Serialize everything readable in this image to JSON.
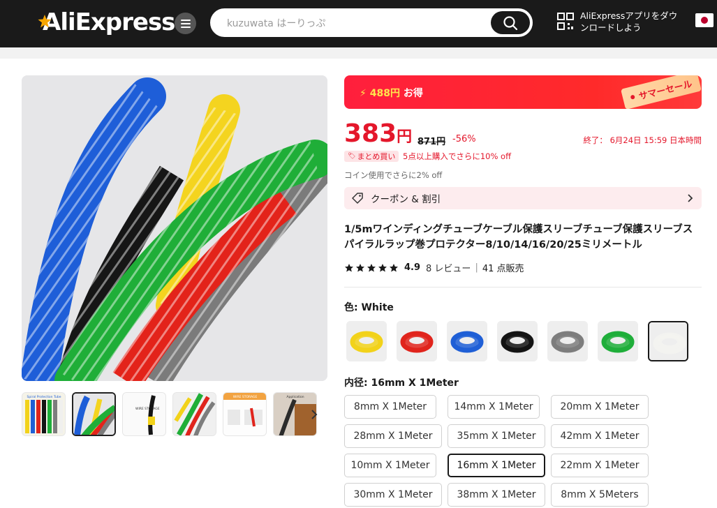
{
  "header": {
    "logo": "AliExpress",
    "search_value": "kuzuwata はーりっぷ",
    "app_promo": "AliExpressアプリをダウンロードしよう"
  },
  "gallery": {
    "thumb_count": 7,
    "thumb_labels": [
      "Spiral Protection Tube",
      "WIRE STORAGE",
      "WIRE STORAGE",
      "Application"
    ]
  },
  "sale": {
    "amount": "488円",
    "suffix": "お得",
    "tag": "サマーセール"
  },
  "price": {
    "current": "383",
    "unit": "円",
    "original": "871円",
    "discount": "-56%",
    "ends": "終了： 6月24日 15:59 日本時間",
    "bulk_badge": "まとめ買い",
    "bulk_text": "5点以上購入でさらに10% off",
    "coin_text": "コイン使用でさらに2% off"
  },
  "coupon": {
    "label": "クーポン & 割引"
  },
  "product": {
    "title": "1/5mワインディングチューブケーブル保護スリーブチューブ保護スリーブスパイラルラップ巻プロテクター8/10/14/16/20/25ミリメートル",
    "rating": "4.9",
    "reviews": "8 レビュー",
    "sold": "41 点販売"
  },
  "color": {
    "label": "色: ",
    "value": "White",
    "swatches": [
      "yellow",
      "red",
      "blue",
      "black",
      "gray",
      "green",
      "white"
    ],
    "swatch_colors": [
      "#f2d21a",
      "#e0241c",
      "#1f5fd6",
      "#141414",
      "#7d7d7d",
      "#1fae3a",
      "#f3f3f0"
    ]
  },
  "size": {
    "label": "内径: ",
    "value": "16mm X 1Meter",
    "options": [
      "8mm X 1Meter",
      "14mm X 1Meter",
      "20mm X 1Meter",
      "28mm X 1Meter",
      "35mm X 1Meter",
      "42mm X 1Meter",
      "10mm X 1Meter",
      "16mm X 1Meter",
      "22mm X 1Meter",
      "30mm X 1Meter",
      "38mm X 1Meter",
      "8mm X 5Meters"
    ]
  },
  "colors": {
    "accent": "#e4172b",
    "header_bg": "#1a1a1a"
  }
}
